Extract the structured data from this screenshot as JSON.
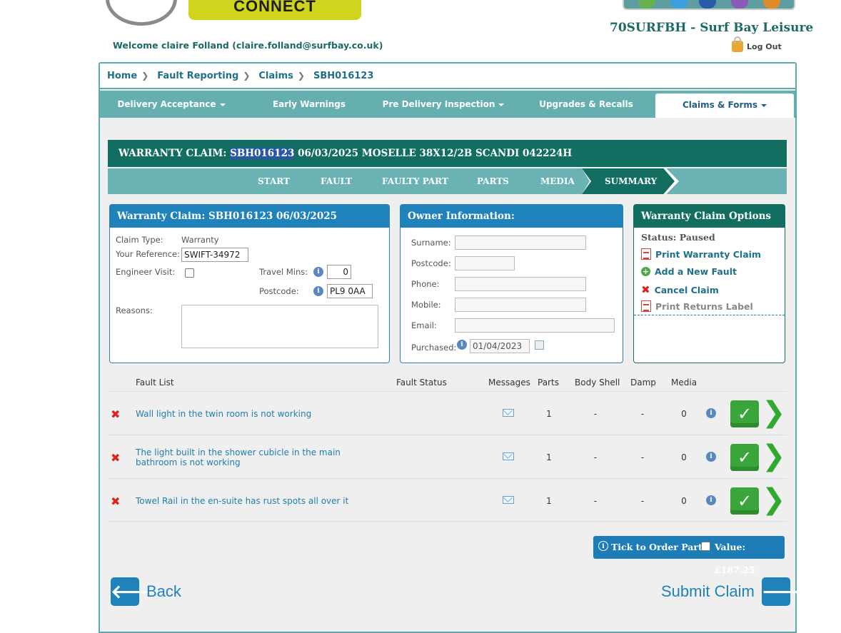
{
  "header": {
    "logo_text": "CONNECT",
    "dealer": "70SURFBH - Surf Bay Leisure",
    "logout": "Log Out",
    "welcome": "Welcome claire Folland (claire.folland@surfbay.co.uk)"
  },
  "breadcrumb": [
    "Home",
    "Fault Reporting",
    "Claims",
    "SBH016123"
  ],
  "topnav": [
    {
      "label": "Delivery Acceptance",
      "dropdown": true
    },
    {
      "label": "Early Warnings",
      "dropdown": false
    },
    {
      "label": "Pre Delivery Inspection",
      "dropdown": true
    },
    {
      "label": "Upgrades & Recalls",
      "dropdown": false
    },
    {
      "label": "Claims & Forms",
      "dropdown": true,
      "active": true
    }
  ],
  "claim_header": {
    "prefix": "WARRANTY CLAIM:",
    "ref": "SBH016123",
    "rest": "06/03/2025 MOSELLE 38X12/2B SCANDI 042224H"
  },
  "steps": [
    "START",
    "FAULT",
    "FAULTY PART",
    "PARTS",
    "MEDIA",
    "SUMMARY"
  ],
  "claim_panel": {
    "title": "Warranty Claim: SBH016123 06/03/2025",
    "claim_type_label": "Claim Type:",
    "claim_type_value": "Warranty",
    "reference_label": "Your Reference:",
    "reference_value": "SWIFT-34972",
    "engineer_label": "Engineer Visit:",
    "travel_label": "Travel Mins:",
    "travel_value": "0",
    "postcode_label": "Postcode:",
    "postcode_value": "PL9 0AA",
    "reasons_label": "Reasons:"
  },
  "owner_panel": {
    "title": "Owner Information:",
    "surname_label": "Surname:",
    "postcode_label": "Postcode:",
    "phone_label": "Phone:",
    "mobile_label": "Mobile:",
    "email_label": "Email:",
    "purchased_label": "Purchased:",
    "purchased_value": "01/04/2023"
  },
  "options_panel": {
    "title": "Warranty Claim Options",
    "status": "Status: Paused",
    "print_claim": "Print Warranty Claim",
    "add_fault": "Add a New Fault",
    "cancel_claim": "Cancel Claim",
    "print_returns": "Print Returns Label"
  },
  "fault_table": {
    "headers": [
      "Fault List",
      "Fault Status",
      "Messages",
      "Parts",
      "Body Shell",
      "Damp",
      "Media"
    ],
    "rows": [
      {
        "text": "Wall light in the twin room is not working",
        "parts": "1",
        "body": "-",
        "damp": "-",
        "media": "0"
      },
      {
        "text": "The light built in the shower cubicle in the main bathroom is not working",
        "parts": "1",
        "body": "-",
        "damp": "-",
        "media": "0"
      },
      {
        "text": "Towel Rail in the en-suite has rust spots all over it",
        "parts": "1",
        "body": "-",
        "damp": "-",
        "media": "0"
      }
    ]
  },
  "order": {
    "tick_label": "Tick to Order Parts:",
    "value_label": "Value: £187.25"
  },
  "buttons": {
    "back": "Back",
    "submit": "Submit Claim"
  },
  "colors": {
    "teal": "#65afb0",
    "dark_green": "#136e62",
    "blue": "#1f82ba",
    "logo_yellow": "#cfd41c"
  }
}
